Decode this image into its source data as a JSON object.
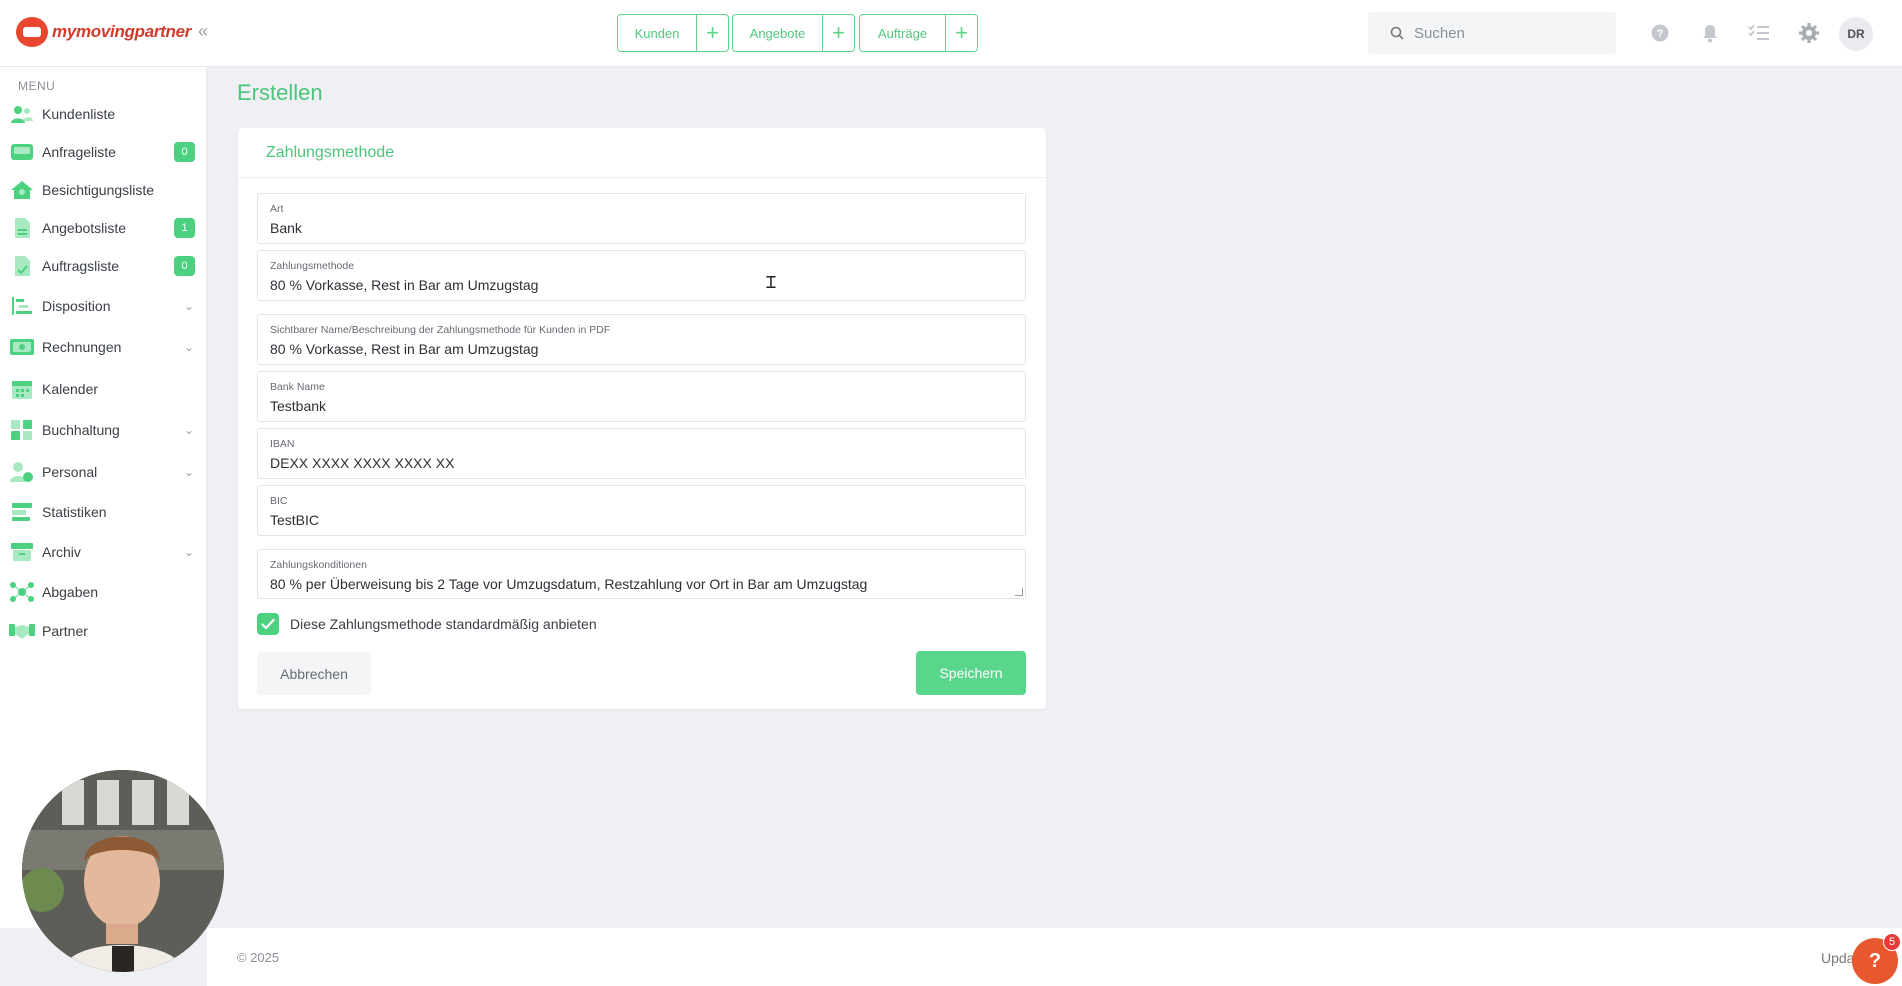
{
  "brand": {
    "name": "mymovingpartner",
    "accent": "#4cc57a",
    "logo_color": "#d33a2c"
  },
  "header": {
    "quick_actions": [
      {
        "label": "Kunden"
      },
      {
        "label": "Angebote"
      },
      {
        "label": "Aufträge"
      }
    ],
    "search": {
      "placeholder": "Suchen"
    },
    "user_initials": "DR"
  },
  "sidebar": {
    "menu_title": "MENU",
    "items": [
      {
        "label": "Kundenliste",
        "icon": "users-icon"
      },
      {
        "label": "Anfrageliste",
        "icon": "inbox-icon",
        "badge": "0"
      },
      {
        "label": "Besichtigungsliste",
        "icon": "home-icon"
      },
      {
        "label": "Angebotsliste",
        "icon": "document-icon",
        "badge": "1"
      },
      {
        "label": "Auftragsliste",
        "icon": "clipboard-icon",
        "badge": "0"
      },
      {
        "label": "Disposition",
        "icon": "gantt-icon",
        "expandable": true
      },
      {
        "label": "Rechnungen",
        "icon": "money-icon",
        "expandable": true
      },
      {
        "label": "Kalender",
        "icon": "calendar-icon"
      },
      {
        "label": "Buchhaltung",
        "icon": "grid-icon",
        "expandable": true
      },
      {
        "label": "Personal",
        "icon": "person-clock-icon",
        "expandable": true
      },
      {
        "label": "Statistiken",
        "icon": "stats-icon"
      },
      {
        "label": "Archiv",
        "icon": "archive-icon",
        "expandable": true
      },
      {
        "label": "Abgaben",
        "icon": "network-icon"
      },
      {
        "label": "Partner",
        "icon": "handshake-icon"
      }
    ]
  },
  "main": {
    "page_title": "Erstellen",
    "card_title": "Zahlungsmethode",
    "fields": [
      {
        "label": "Art",
        "value": "Bank"
      },
      {
        "label": "Zahlungsmethode",
        "value": "80 % Vorkasse, Rest in Bar am Umzugstag"
      },
      {
        "label": "Sichtbarer Name/Beschreibung der Zahlungsmethode für Kunden in PDF",
        "value": "80 % Vorkasse, Rest in Bar am Umzugstag"
      },
      {
        "label": "Bank Name",
        "value": "Testbank"
      },
      {
        "label": "IBAN",
        "value": "DEXX XXXX XXXX XXXX XX"
      },
      {
        "label": "BIC",
        "value": "TestBIC"
      },
      {
        "label": "Zahlungskonditionen",
        "value": "80 % per Überweisung bis 2 Tage vor Umzugsdatum, Restzahlung vor Ort in Bar am Umzugstag"
      }
    ],
    "default_checkbox": {
      "label": "Diese Zahlungsmethode standardmäßig anbieten",
      "checked": true
    },
    "cancel_label": "Abbrechen",
    "save_label": "Speichern"
  },
  "footer": {
    "copyright": "© 2025",
    "update_text": "Upda",
    "help_badge": "5"
  }
}
